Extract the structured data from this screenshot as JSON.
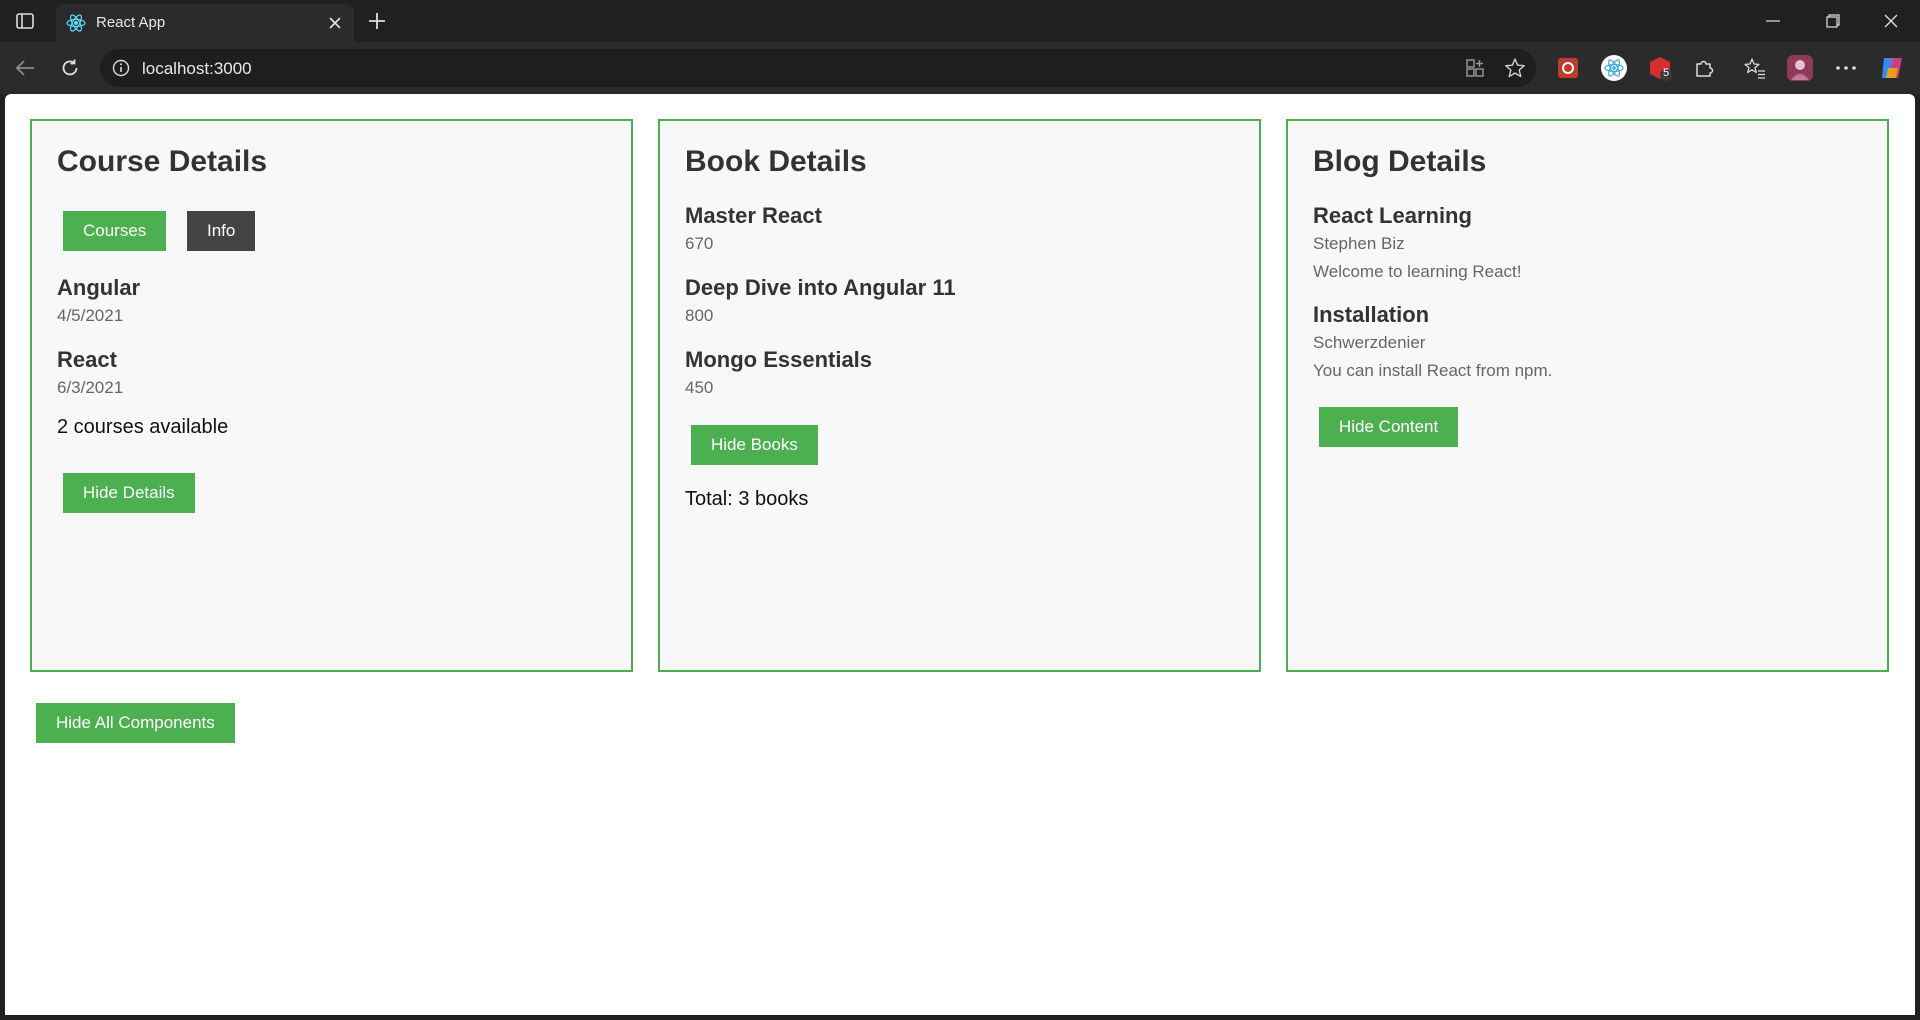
{
  "browser": {
    "tab_title": "React App",
    "url": "localhost:3000",
    "extension_badge": "5"
  },
  "course": {
    "title": "Course Details",
    "tab_courses": "Courses",
    "tab_info": "Info",
    "items": [
      {
        "name": "Angular",
        "date": "4/5/2021"
      },
      {
        "name": "React",
        "date": "6/3/2021"
      }
    ],
    "summary": "2 courses available",
    "hide_button": "Hide Details"
  },
  "book": {
    "title": "Book Details",
    "items": [
      {
        "name": "Master React",
        "price": "670"
      },
      {
        "name": "Deep Dive into Angular 11",
        "price": "800"
      },
      {
        "name": "Mongo Essentials",
        "price": "450"
      }
    ],
    "hide_button": "Hide Books",
    "total": "Total: 3 books"
  },
  "blog": {
    "title": "Blog Details",
    "items": [
      {
        "title": "React Learning",
        "author": "Stephen Biz",
        "content": "Welcome to learning React!"
      },
      {
        "title": "Installation",
        "author": "Schwerzdenier",
        "content": "You can install React from npm."
      }
    ],
    "hide_button": "Hide Content"
  },
  "global": {
    "hide_all_button": "Hide All Components"
  },
  "colors": {
    "accent_green": "#4caf50",
    "dark_button": "#444444",
    "panel_bg": "#f8f8f8"
  }
}
